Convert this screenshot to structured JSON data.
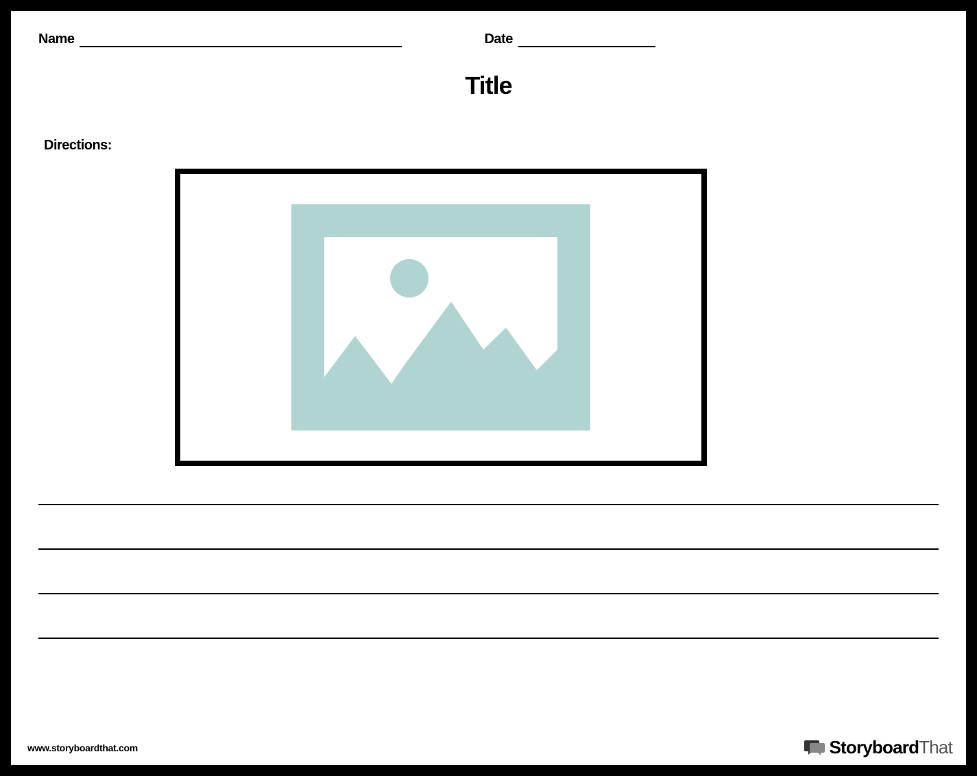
{
  "header": {
    "name_label": "Name",
    "date_label": "Date"
  },
  "title": "Title",
  "directions_label": "Directions:",
  "placeholder": {
    "icon_name": "image-placeholder",
    "color": "#b0d4d2"
  },
  "writing_lines_count": 4,
  "footer": {
    "url": "www.storyboardthat.com",
    "brand_bold": "Storyboard",
    "brand_light": "That"
  }
}
